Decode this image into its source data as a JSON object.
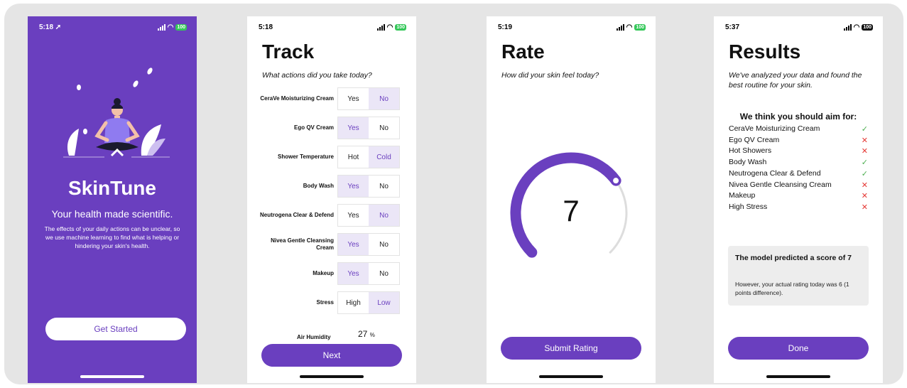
{
  "screen_welcome": {
    "status": {
      "time": "5:18",
      "location_arrow": "➚",
      "battery": "100"
    },
    "illustration": "meditation-illustration",
    "app_name": "SkinTune",
    "tagline": "Your health made scientific.",
    "description": "The effects of your daily actions can be unclear, so we use machine learning to find what is helping or hindering your skin's health.",
    "cta_label": "Get Started"
  },
  "screen_track": {
    "status": {
      "time": "5:18",
      "battery": "100"
    },
    "title": "Track",
    "subtitle": "What actions did you take today?",
    "rows": [
      {
        "label": "CeraVe Moisturizing Cream",
        "options": [
          "Yes",
          "No"
        ],
        "selected": "No"
      },
      {
        "label": "Ego QV Cream",
        "options": [
          "Yes",
          "No"
        ],
        "selected": "Yes"
      },
      {
        "label": "Shower Temperature",
        "options": [
          "Hot",
          "Cold"
        ],
        "selected": "Cold"
      },
      {
        "label": "Body Wash",
        "options": [
          "Yes",
          "No"
        ],
        "selected": "Yes"
      },
      {
        "label": "Neutrogena Clear & Defend",
        "options": [
          "Yes",
          "No"
        ],
        "selected": "No"
      },
      {
        "label": "Nivea Gentle Cleansing Cream",
        "options": [
          "Yes",
          "No"
        ],
        "selected": "Yes"
      },
      {
        "label": "Makeup",
        "options": [
          "Yes",
          "No"
        ],
        "selected": "Yes"
      },
      {
        "label": "Stress",
        "options": [
          "High",
          "Low"
        ],
        "selected": "Low"
      }
    ],
    "air_humidity_label": "Air Humidity",
    "air_humidity_value": "27",
    "air_humidity_unit": "%",
    "next_label": "Next"
  },
  "screen_rate": {
    "status": {
      "time": "5:19",
      "battery": "100"
    },
    "title": "Rate",
    "subtitle": "How did your skin feel today?",
    "rating": "7",
    "rating_fraction": 0.7,
    "submit_label": "Submit Rating"
  },
  "screen_results": {
    "status": {
      "time": "5:37",
      "battery": "100"
    },
    "title": "Results",
    "subtitle": "We've analyzed your data and found the best routine for your skin.",
    "aim_heading": "We think you should aim for:",
    "items": [
      {
        "name": "CeraVe Moisturizing Cream",
        "mark": "✓",
        "ok": true
      },
      {
        "name": "Ego QV Cream",
        "mark": "✕",
        "ok": false
      },
      {
        "name": "Hot Showers",
        "mark": "✕",
        "ok": false
      },
      {
        "name": "Body Wash",
        "mark": "✓",
        "ok": true
      },
      {
        "name": "Neutrogena Clear & Defend",
        "mark": "✓",
        "ok": true
      },
      {
        "name": "Nivea Gentle Cleansing Cream",
        "mark": "✕",
        "ok": false
      },
      {
        "name": "Makeup",
        "mark": "✕",
        "ok": false
      },
      {
        "name": "High Stress",
        "mark": "✕",
        "ok": false
      }
    ],
    "prediction_title": "The model predicted a score of 7",
    "prediction_body": "However, your actual rating today was 6 (1 points difference).",
    "done_label": "Done"
  },
  "colors": {
    "accent": "#6a3fbf",
    "selected_bg": "#ebe6f7",
    "check": "#4caf50",
    "cross": "#e53935",
    "track": "#dddddd"
  }
}
